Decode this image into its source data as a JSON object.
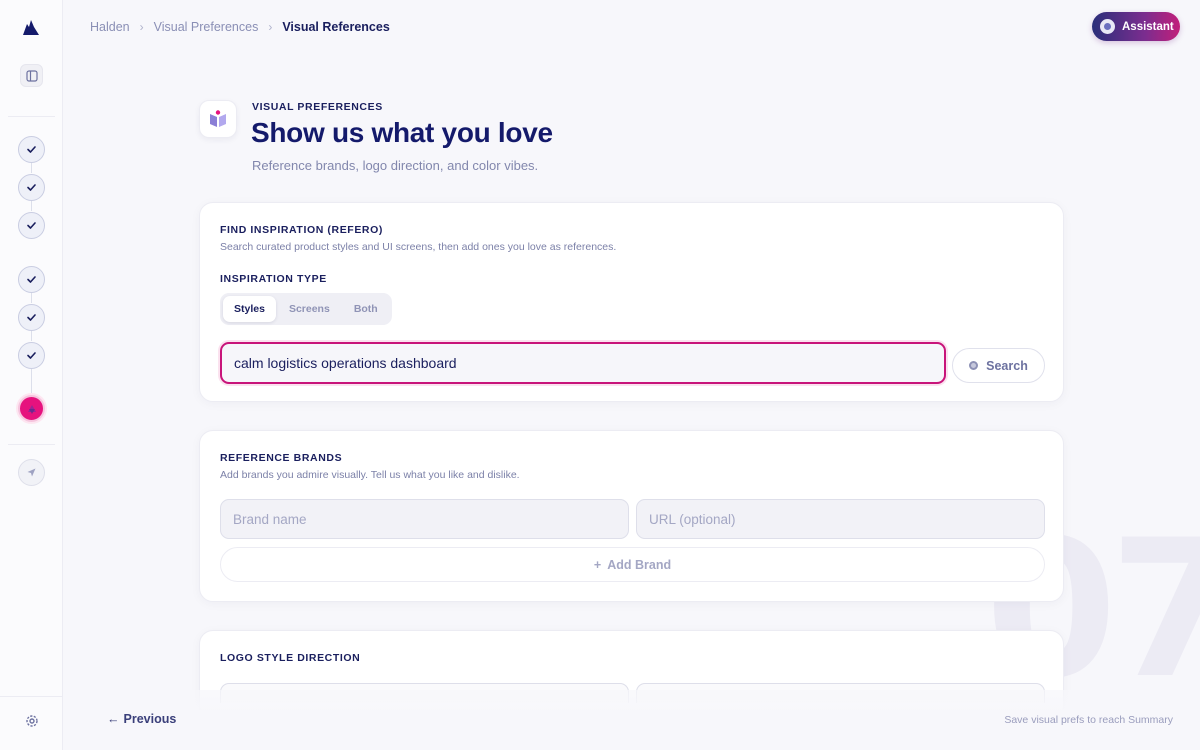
{
  "breadcrumb": {
    "items": [
      "Halden",
      "Visual Preferences",
      "Visual References"
    ]
  },
  "assistant": {
    "label": "Assistant"
  },
  "heading": {
    "eyebrow": "VISUAL PREFERENCES",
    "title": "Show us what you love",
    "subtitle": "Reference brands, logo direction, and color vibes."
  },
  "watermark": "07",
  "inspiration": {
    "title": "FIND INSPIRATION (REFERO)",
    "description": "Search curated product styles and UI screens, then add ones you love as references.",
    "type_label": "INSPIRATION TYPE",
    "types": [
      "Styles",
      "Screens",
      "Both"
    ],
    "selected_type": "Styles",
    "search_value": "calm logistics operations dashboard",
    "search_button": "Search"
  },
  "brands": {
    "title": "REFERENCE BRANDS",
    "description": "Add brands you admire visually. Tell us what you like and dislike.",
    "name_placeholder": "Brand name",
    "url_placeholder": "URL (optional)",
    "add_button": "Add Brand",
    "add_symbol": "+"
  },
  "logo_direction": {
    "title": "LOGO STYLE DIRECTION"
  },
  "footer": {
    "previous": "Previous",
    "previous_arrow": "←",
    "hint": "Save visual prefs to reach Summary"
  },
  "colors": {
    "accent": "#e6127e",
    "navy": "#141a6b",
    "focus_border": "#c8147a"
  },
  "icons": {
    "logo": "brand-logo-icon",
    "panel": "panel-toggle-icon",
    "step_done": "check-icon",
    "step_active": "palette-icon",
    "step_next": "send-icon",
    "settings": "gear-icon",
    "heading": "book-icon"
  }
}
